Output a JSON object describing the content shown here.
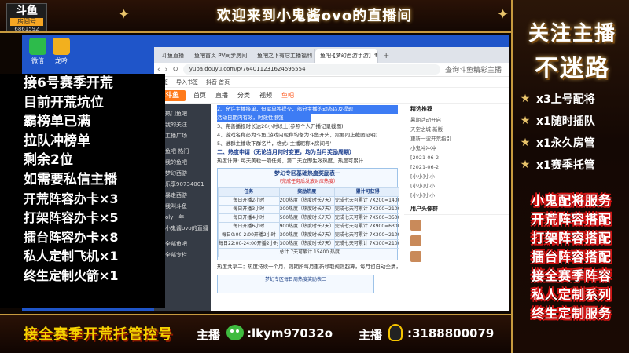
{
  "overlay": {
    "logo_main": "斗鱼",
    "logo_sub": "房间号",
    "logo_id": "6861592",
    "top_title": "欢迎来到小鬼酱ovo的直播间",
    "follow_line1": "关注主播",
    "follow_line2": "不迷路",
    "perks": [
      {
        "icon": "star-icon",
        "label": "x3上号配将"
      },
      {
        "icon": "star-icon",
        "label": "x1随时插队"
      },
      {
        "icon": "star-icon",
        "label": "x1永久房管"
      },
      {
        "icon": "star-icon",
        "label": "x1赛季托管"
      }
    ],
    "services": [
      "小鬼配将服务",
      "开荒阵容搭配",
      "打架阵容搭配",
      "擂台阵容搭配",
      "接全赛季阵容",
      "私人定制系列",
      "终生定制服务"
    ],
    "left_lines": [
      "接6号赛季开荒",
      "目前开荒坑位",
      "霸榜单已满",
      "拉队冲榜单",
      "剩余2位",
      "如需要私信主播",
      "开荒阵容办卡×3",
      "打架阵容办卡×5",
      "擂台阵容办卡×8",
      "私人定制飞机×1",
      "终生定制火箭×1"
    ],
    "bottom_left": "接全赛季开荒托管控号",
    "wx_label": "主播",
    "wx_id": ":lkym97032o",
    "qq_label": "主播",
    "qq_id": ":3188800079"
  },
  "desktop": {
    "icons": [
      {
        "name": "wechat",
        "label": "微信"
      },
      {
        "name": "game",
        "label": "龙吟"
      }
    ]
  },
  "browser": {
    "tabs": [
      "斗鱼直播",
      "鱼吧首页 PV同步房间",
      "鱼吧之下有它主播福利",
      "鱼吧·【梦幻西游手游】专区"
    ],
    "url": "yuba.douyu.com/p/764011231624595554",
    "search_hint": "查询斗鱼精彩主播",
    "bookmarks": [
      "书签",
      "导入书签",
      "抖音·首页"
    ],
    "site_logo": "斗鱼",
    "site_nav": [
      "首页",
      "直播",
      "分类",
      "视频",
      "鱼吧"
    ],
    "sidebar": [
      "热门鱼吧",
      "我的关注",
      "主播广场",
      "鱼吧·热门",
      "我的鱼吧",
      "梦幻西游",
      "乐享90734001",
      "暴走西游",
      "我叫斗鱼",
      "oly一年",
      "小鬼酱ovo的直播"
    ],
    "sidebar2": [
      "全部鱼吧",
      "全部专栏"
    ],
    "article": {
      "highlight_1": "2、允许主播接单，但需单独提交，部分主播的动态以及提现",
      "highlight_2": "活动日期内有效，时效性很强",
      "line_3": "3、完善播报时长达20小时以上(参照个人开播记录截图)",
      "line_4": "4、游戏名称必为斗鱼(游戏内昵称均备为斗鱼开头，需要同上截图证明)",
      "line_5": "5、进群主播收下群名片，格式:'主播昵称+房间号'",
      "section_2": "二、热度申请（无论当月何时变更，均为当月奖励周期）",
      "rule": "热度计算: 每天美粒一项任务，第二天立即生效热度，热度可累计",
      "poster_title": "梦幻专区基础热度奖励表一",
      "poster_sub": "（完成任务后发放对应热度）",
      "table_head": [
        "任务",
        "奖励热度",
        "累计可获得"
      ],
      "rows": [
        [
          "每日开播2小时",
          "200热度（热度时长7天）",
          "完成七天可累计 7X200=1400"
        ],
        [
          "每日开播3小时",
          "300热度（热度时长7天）",
          "完成七天可累计 7X300=2100"
        ],
        [
          "每日开播4小时",
          "500热度（热度时长7天）",
          "完成七天可累计 7X500=3500"
        ],
        [
          "每日开播6小时",
          "900热度（热度时长7天）",
          "完成七天可累计 7X900=6300"
        ],
        [
          "每日0:00-2:00开播2小时",
          "300热度（热度时长7天）",
          "完成七天可累计 7X300=2100"
        ],
        [
          "每日22:00-24:00开播2小时",
          "300热度（热度时长7天）",
          "完成七天可累计 7X300=2100"
        ]
      ],
      "total": "总计 7天可累计 15400 热度",
      "note": "热度共享二：热度持续一个月，则期所每月重新领取规则起算，每月初自动全清，除名各单公布在群置",
      "poster2": "梦幻专区每日周热度奖励表二"
    },
    "right_col": [
      "精选推荐",
      "暑期活动开启",
      "天空之城·新版",
      "更新一波开荒指引",
      "小鬼冲冲冲",
      "[2021-06-2",
      "[2021-06-2",
      "[小小]小小",
      "[小小]小小",
      "[小小]小小"
    ],
    "right_footer": "用户头像群"
  },
  "colors": {
    "gold": "#c79a3f",
    "red_outline": "#d01414",
    "yellow": "#f5d300",
    "desktop_blue": "#1f55c9"
  }
}
